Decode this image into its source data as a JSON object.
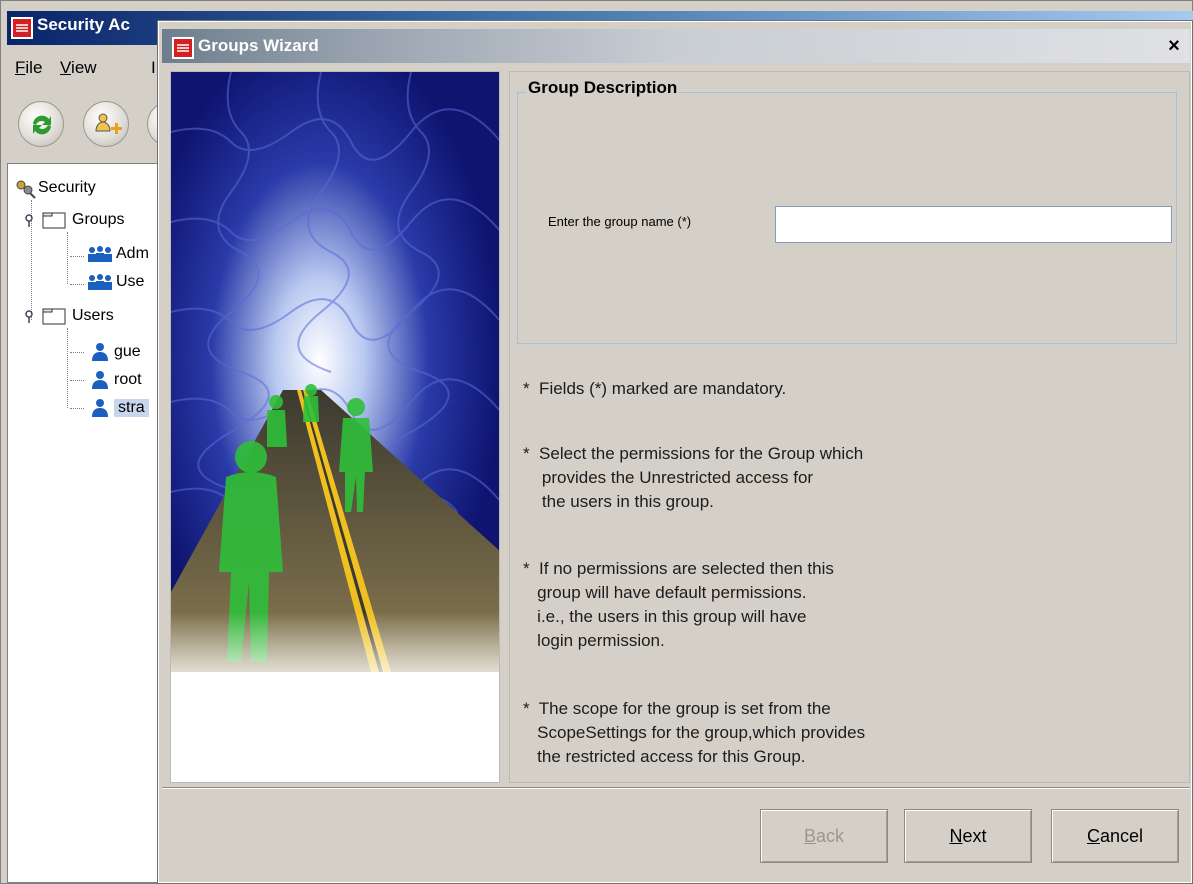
{
  "background_app": {
    "title": "Security Ac",
    "menus": [
      {
        "label": "File",
        "mnemonic": "F",
        "rest": "ile"
      },
      {
        "label": "View",
        "mnemonic": "V",
        "rest": "iew"
      },
      {
        "label": "I",
        "mnemonic": "",
        "rest": "I"
      }
    ],
    "toolbar": [
      {
        "icon": "refresh-icon"
      },
      {
        "icon": "add-user-icon"
      },
      {
        "icon": "unknown-tool-icon"
      }
    ],
    "tree": {
      "root": "Security",
      "groups_label": "Groups",
      "groups": [
        "Adm",
        "Use"
      ],
      "users_label": "Users",
      "users": [
        "gue",
        "root",
        "stra"
      ],
      "selected_user": "stra"
    }
  },
  "dialog": {
    "title": "Groups Wizard",
    "close_label": "×",
    "group_box": {
      "legend": "Group Description",
      "field_label": "Enter the group name (*)",
      "field_value": "",
      "field_placeholder": ""
    },
    "notes": [
      "*  Fields (*) marked are mandatory.",
      "*  Select the permissions for the Group which\n    provides the Unrestricted access for\n    the users in this group.",
      "*  If no permissions are selected then this\n   group will have default permissions.\n   i.e., the users in this group will have\n   login permission.",
      "*  The scope for the group is set from the\n   ScopeSettings for the group,which provides\n   the restricted access for this Group."
    ],
    "buttons": {
      "back": {
        "mnemonic": "B",
        "rest": "ack",
        "enabled": false
      },
      "next": {
        "mnemonic": "N",
        "rest": "ext",
        "enabled": true
      },
      "cancel": {
        "mnemonic": "C",
        "rest": "ancel",
        "enabled": true
      }
    }
  },
  "colors": {
    "dialog_bg": "#d4d0c8",
    "group_box_border": "#a8bfd6",
    "input_border": "#7f9db9",
    "tree_selection": "#c8d6ec",
    "title_active": "#0a246a"
  }
}
